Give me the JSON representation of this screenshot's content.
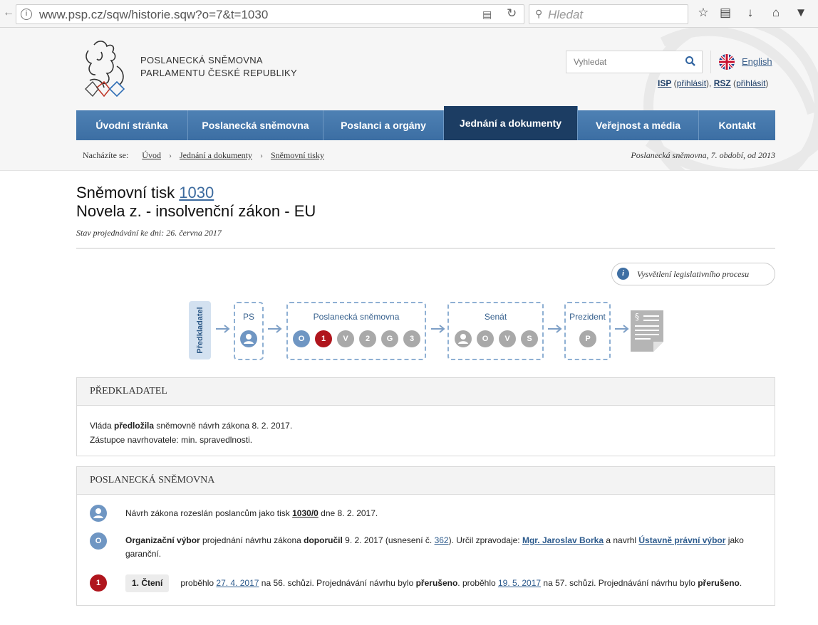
{
  "browser": {
    "url": "www.psp.cz/sqw/historie.sqw?o=7&t=1030",
    "search_placeholder": "Hledat",
    "toolbar_icons": [
      "star-icon",
      "library-icon",
      "download-icon",
      "home-icon",
      "pocket-icon"
    ]
  },
  "site": {
    "brand_line1": "POSLANECKÁ SNĚMOVNA",
    "brand_line2": "PARLAMENTU ČESKÉ REPUBLIKY",
    "search_placeholder": "Vyhledat",
    "language": "English",
    "isp": "ISP",
    "rsz": "RSZ",
    "login_label": "přihlásit",
    "colors": {
      "nav": "#4e81b4",
      "nav_active": "#1c3d63",
      "accent": "#b0151d"
    }
  },
  "nav": [
    {
      "label": "Úvodní stránka",
      "active": false
    },
    {
      "label": "Poslanecká sněmovna",
      "active": false
    },
    {
      "label": "Poslanci a orgány",
      "active": false
    },
    {
      "label": "Jednání a dokumenty",
      "active": true
    },
    {
      "label": "Veřejnost a média",
      "active": false
    },
    {
      "label": "Kontakt",
      "active": false
    }
  ],
  "breadcrumb": {
    "prefix": "Nacházíte se:",
    "items": [
      "Úvod",
      "Jednání a dokumenty",
      "Sněmovní tisky"
    ],
    "period": "Poslanecká sněmovna, 7. období, od 2013"
  },
  "print": {
    "title_prefix": "Sněmovní tisk",
    "number": "1030",
    "subtitle": "Novela z. - insolvenční zákon - EU",
    "state": "Stav projednávání ke dni: 26. června 2017",
    "explain_link": "Vysvětlení legislativního procesu"
  },
  "process": {
    "predkladatel": "Předkladatel",
    "ps_label": "PS",
    "snemovna_label": "Poslanecká sněmovna",
    "senat_label": "Senát",
    "prezident_label": "Prezident",
    "snemovna_steps": [
      "O",
      "1",
      "V",
      "2",
      "G",
      "3"
    ],
    "senat_steps": [
      "O",
      "V",
      "S"
    ],
    "prezident_steps": [
      "P"
    ]
  },
  "panel_predkladatel": {
    "heading": "PŘEDKLADATEL",
    "line1_a": "Vláda ",
    "line1_b": "předložila",
    "line1_c": " sněmovně návrh zákona 8. 2. 2017.",
    "line2": "Zástupce navrhovatele: min. spravedlnosti."
  },
  "panel_snemovna": {
    "heading": "POSLANECKÁ SNĚMOVNA",
    "row1": {
      "text_a": "Návrh zákona rozeslán poslancům jako tisk ",
      "link": "1030/0",
      "text_b": " dne 8. 2. 2017."
    },
    "row2": {
      "icon": "O",
      "committee": "Organizační výbor",
      "text_a": " projednání návrhu zákona ",
      "bold": "doporučil",
      "text_b": " 9. 2. 2017 (usnesení č. ",
      "resolution": "362",
      "text_c": "). Určil zpravodaje: ",
      "rapporteur": "Mgr. Jaroslav Borka",
      "text_d": " a navrhl ",
      "committee2": "Ústavně právní výbor",
      "text_e": " jako garanční."
    },
    "row3": {
      "icon": "1",
      "badge": "1. Čtení",
      "t1": "proběhlo ",
      "date1": "27. 4. 2017",
      "t2": " na 56. schůzi. Projednávání návrhu bylo ",
      "b1": "přerušeno",
      "t3": ". proběhlo ",
      "date2": "19. 5. 2017",
      "t4": " na 57. schůzi. Projednávání návrhu bylo ",
      "b2": "přerušeno",
      "t5": "."
    }
  }
}
